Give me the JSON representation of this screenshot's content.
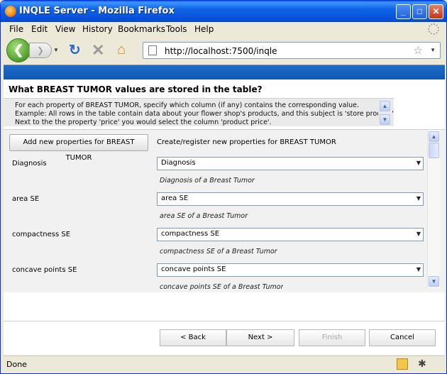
{
  "window": {
    "title": "INQLE Server - Mozilla Firefox",
    "controls": {
      "minimize": "_",
      "maximize": "□",
      "close": "✕"
    }
  },
  "menubar": {
    "items": [
      {
        "label": "File"
      },
      {
        "label": "Edit"
      },
      {
        "label": "View"
      },
      {
        "label": "History"
      },
      {
        "label": "Bookmarks"
      },
      {
        "label": "Tools"
      },
      {
        "label": "Help"
      }
    ]
  },
  "navbar": {
    "url": "http://localhost:7500/inqle",
    "icons": [
      "back-icon",
      "forward-icon",
      "reload-icon",
      "stop-icon",
      "home-icon",
      "page-icon",
      "bookmark-star-icon"
    ]
  },
  "page": {
    "question": "What BREAST TUMOR values are stored in the table?",
    "instructions": [
      "For each property of BREAST TUMOR, specify which column (if any) contains the corresponding value.",
      "Example: All rows in the table contain data about your flower shop's products, and this subject is 'store product'.",
      "Next to the the property 'price' you would select the column 'product price'."
    ],
    "add_button": "Add new properties for BREAST TUMOR",
    "add_description": "Create/register new properties for BREAST TUMOR",
    "properties": [
      {
        "label": "Diagnosis",
        "selected": "Diagnosis",
        "description": "Diagnosis of a Breast Tumor"
      },
      {
        "label": "area SE",
        "selected": "area SE",
        "description": "area SE of a Breast Tumor"
      },
      {
        "label": "compactness SE",
        "selected": "compactness SE",
        "description": "compactness SE of a Breast Tumor"
      },
      {
        "label": "concave points SE",
        "selected": "concave points SE",
        "description": "concave points SE of a Breast Tumor"
      }
    ],
    "wizard": {
      "back": "< Back",
      "next": "Next >",
      "finish": "Finish",
      "cancel": "Cancel"
    }
  },
  "statusbar": {
    "text": "Done"
  }
}
